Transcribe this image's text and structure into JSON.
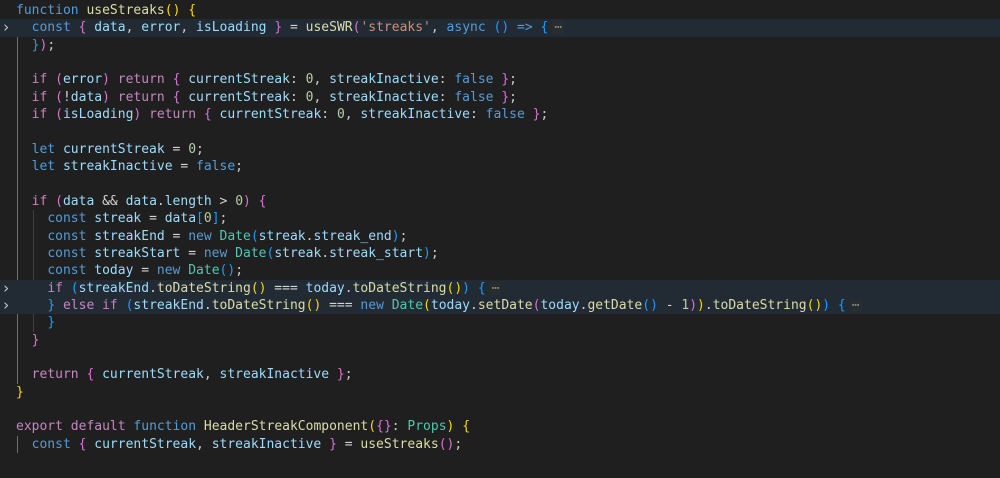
{
  "colors": {
    "keyword": "#569cd6",
    "control": "#c586c0",
    "function": "#dcdcaa",
    "variable": "#9cdcfe",
    "property": "#9cdcfe",
    "type": "#4ec9b0",
    "string": "#ce9178",
    "number": "#b5cea8",
    "operator": "#d4d4d4",
    "punctuation": "#cccccc",
    "bracket1": "#ffd700",
    "bracket2": "#da70d6",
    "bracket3": "#179fff",
    "ellipsis": "#8a8a8a"
  },
  "fold_icon": "chevron-right-icon",
  "ellipsis_text": "⋯",
  "lines": [
    {
      "fold": false,
      "tokens": [
        [
          "function",
          "keyword"
        ],
        [
          " ",
          "text"
        ],
        [
          "useStreaks",
          "function"
        ],
        [
          "(",
          "bracket1"
        ],
        [
          ")",
          "bracket1"
        ],
        [
          " ",
          "text"
        ],
        [
          "{",
          "bracket1"
        ]
      ]
    },
    {
      "fold": true,
      "collapsed": true,
      "tokens": [
        [
          "  ",
          "text"
        ],
        [
          "const",
          "keyword"
        ],
        [
          " ",
          "text"
        ],
        [
          "{",
          "bracket2"
        ],
        [
          " ",
          "text"
        ],
        [
          "data",
          "variable"
        ],
        [
          ", ",
          "text"
        ],
        [
          "error",
          "variable"
        ],
        [
          ", ",
          "text"
        ],
        [
          "isLoading",
          "variable"
        ],
        [
          " ",
          "text"
        ],
        [
          "}",
          "bracket2"
        ],
        [
          " = ",
          "operator"
        ],
        [
          "useSWR",
          "function"
        ],
        [
          "(",
          "bracket2"
        ],
        [
          "'streaks'",
          "string"
        ],
        [
          ", ",
          "text"
        ],
        [
          "async",
          "keyword"
        ],
        [
          " ",
          "text"
        ],
        [
          "(",
          "bracket3"
        ],
        [
          ")",
          "bracket3"
        ],
        [
          " ",
          "text"
        ],
        [
          "=>",
          "keyword"
        ],
        [
          " ",
          "text"
        ],
        [
          "{",
          "bracket3"
        ]
      ]
    },
    {
      "fold": false,
      "tokens": [
        [
          "  ",
          "text"
        ],
        [
          "}",
          "bracket3"
        ],
        [
          ")",
          "bracket2"
        ],
        [
          ";",
          "text"
        ]
      ]
    },
    {
      "fold": false,
      "tokens": []
    },
    {
      "fold": false,
      "tokens": [
        [
          "  ",
          "text"
        ],
        [
          "if",
          "control"
        ],
        [
          " ",
          "text"
        ],
        [
          "(",
          "bracket2"
        ],
        [
          "error",
          "variable"
        ],
        [
          ")",
          "bracket2"
        ],
        [
          " ",
          "text"
        ],
        [
          "return",
          "control"
        ],
        [
          " ",
          "text"
        ],
        [
          "{",
          "bracket2"
        ],
        [
          " ",
          "text"
        ],
        [
          "currentStreak",
          "property"
        ],
        [
          ": ",
          "text"
        ],
        [
          "0",
          "number"
        ],
        [
          ", ",
          "text"
        ],
        [
          "streakInactive",
          "property"
        ],
        [
          ": ",
          "text"
        ],
        [
          "false",
          "keyword"
        ],
        [
          " ",
          "text"
        ],
        [
          "}",
          "bracket2"
        ],
        [
          ";",
          "text"
        ]
      ]
    },
    {
      "fold": false,
      "tokens": [
        [
          "  ",
          "text"
        ],
        [
          "if",
          "control"
        ],
        [
          " ",
          "text"
        ],
        [
          "(",
          "bracket2"
        ],
        [
          "!",
          "operator"
        ],
        [
          "data",
          "variable"
        ],
        [
          ")",
          "bracket2"
        ],
        [
          " ",
          "text"
        ],
        [
          "return",
          "control"
        ],
        [
          " ",
          "text"
        ],
        [
          "{",
          "bracket2"
        ],
        [
          " ",
          "text"
        ],
        [
          "currentStreak",
          "property"
        ],
        [
          ": ",
          "text"
        ],
        [
          "0",
          "number"
        ],
        [
          ", ",
          "text"
        ],
        [
          "streakInactive",
          "property"
        ],
        [
          ": ",
          "text"
        ],
        [
          "false",
          "keyword"
        ],
        [
          " ",
          "text"
        ],
        [
          "}",
          "bracket2"
        ],
        [
          ";",
          "text"
        ]
      ]
    },
    {
      "fold": false,
      "tokens": [
        [
          "  ",
          "text"
        ],
        [
          "if",
          "control"
        ],
        [
          " ",
          "text"
        ],
        [
          "(",
          "bracket2"
        ],
        [
          "isLoading",
          "variable"
        ],
        [
          ")",
          "bracket2"
        ],
        [
          " ",
          "text"
        ],
        [
          "return",
          "control"
        ],
        [
          " ",
          "text"
        ],
        [
          "{",
          "bracket2"
        ],
        [
          " ",
          "text"
        ],
        [
          "currentStreak",
          "property"
        ],
        [
          ": ",
          "text"
        ],
        [
          "0",
          "number"
        ],
        [
          ", ",
          "text"
        ],
        [
          "streakInactive",
          "property"
        ],
        [
          ": ",
          "text"
        ],
        [
          "false",
          "keyword"
        ],
        [
          " ",
          "text"
        ],
        [
          "}",
          "bracket2"
        ],
        [
          ";",
          "text"
        ]
      ]
    },
    {
      "fold": false,
      "tokens": []
    },
    {
      "fold": false,
      "tokens": [
        [
          "  ",
          "text"
        ],
        [
          "let",
          "keyword"
        ],
        [
          " ",
          "text"
        ],
        [
          "currentStreak",
          "variable"
        ],
        [
          " = ",
          "operator"
        ],
        [
          "0",
          "number"
        ],
        [
          ";",
          "text"
        ]
      ]
    },
    {
      "fold": false,
      "tokens": [
        [
          "  ",
          "text"
        ],
        [
          "let",
          "keyword"
        ],
        [
          " ",
          "text"
        ],
        [
          "streakInactive",
          "variable"
        ],
        [
          " = ",
          "operator"
        ],
        [
          "false",
          "keyword"
        ],
        [
          ";",
          "text"
        ]
      ]
    },
    {
      "fold": false,
      "tokens": []
    },
    {
      "fold": false,
      "tokens": [
        [
          "  ",
          "text"
        ],
        [
          "if",
          "control"
        ],
        [
          " ",
          "text"
        ],
        [
          "(",
          "bracket2"
        ],
        [
          "data",
          "variable"
        ],
        [
          " && ",
          "operator"
        ],
        [
          "data",
          "variable"
        ],
        [
          ".",
          "text"
        ],
        [
          "length",
          "property"
        ],
        [
          " > ",
          "operator"
        ],
        [
          "0",
          "number"
        ],
        [
          ")",
          "bracket2"
        ],
        [
          " ",
          "text"
        ],
        [
          "{",
          "bracket2"
        ]
      ]
    },
    {
      "fold": false,
      "tokens": [
        [
          "    ",
          "text"
        ],
        [
          "const",
          "keyword"
        ],
        [
          " ",
          "text"
        ],
        [
          "streak",
          "variable"
        ],
        [
          " = ",
          "operator"
        ],
        [
          "data",
          "variable"
        ],
        [
          "[",
          "bracket3"
        ],
        [
          "0",
          "number"
        ],
        [
          "]",
          "bracket3"
        ],
        [
          ";",
          "text"
        ]
      ]
    },
    {
      "fold": false,
      "tokens": [
        [
          "    ",
          "text"
        ],
        [
          "const",
          "keyword"
        ],
        [
          " ",
          "text"
        ],
        [
          "streakEnd",
          "variable"
        ],
        [
          " = ",
          "operator"
        ],
        [
          "new",
          "keyword"
        ],
        [
          " ",
          "text"
        ],
        [
          "Date",
          "type"
        ],
        [
          "(",
          "bracket3"
        ],
        [
          "streak",
          "variable"
        ],
        [
          ".",
          "text"
        ],
        [
          "streak_end",
          "property"
        ],
        [
          ")",
          "bracket3"
        ],
        [
          ";",
          "text"
        ]
      ]
    },
    {
      "fold": false,
      "tokens": [
        [
          "    ",
          "text"
        ],
        [
          "const",
          "keyword"
        ],
        [
          " ",
          "text"
        ],
        [
          "streakStart",
          "variable"
        ],
        [
          " = ",
          "operator"
        ],
        [
          "new",
          "keyword"
        ],
        [
          " ",
          "text"
        ],
        [
          "Date",
          "type"
        ],
        [
          "(",
          "bracket3"
        ],
        [
          "streak",
          "variable"
        ],
        [
          ".",
          "text"
        ],
        [
          "streak_start",
          "property"
        ],
        [
          ")",
          "bracket3"
        ],
        [
          ";",
          "text"
        ]
      ]
    },
    {
      "fold": false,
      "tokens": [
        [
          "    ",
          "text"
        ],
        [
          "const",
          "keyword"
        ],
        [
          " ",
          "text"
        ],
        [
          "today",
          "variable"
        ],
        [
          " = ",
          "operator"
        ],
        [
          "new",
          "keyword"
        ],
        [
          " ",
          "text"
        ],
        [
          "Date",
          "type"
        ],
        [
          "(",
          "bracket3"
        ],
        [
          ")",
          "bracket3"
        ],
        [
          ";",
          "text"
        ]
      ]
    },
    {
      "fold": true,
      "collapsed": true,
      "tokens": [
        [
          "    ",
          "text"
        ],
        [
          "if",
          "control"
        ],
        [
          " ",
          "text"
        ],
        [
          "(",
          "bracket3"
        ],
        [
          "streakEnd",
          "variable"
        ],
        [
          ".",
          "text"
        ],
        [
          "toDateString",
          "function"
        ],
        [
          "(",
          "bracket1"
        ],
        [
          ")",
          "bracket1"
        ],
        [
          " === ",
          "operator"
        ],
        [
          "today",
          "variable"
        ],
        [
          ".",
          "text"
        ],
        [
          "toDateString",
          "function"
        ],
        [
          "(",
          "bracket1"
        ],
        [
          ")",
          "bracket1"
        ],
        [
          ")",
          "bracket3"
        ],
        [
          " ",
          "text"
        ],
        [
          "{",
          "bracket3"
        ]
      ]
    },
    {
      "fold": true,
      "collapsed": true,
      "tokens": [
        [
          "    ",
          "text"
        ],
        [
          "}",
          "bracket3"
        ],
        [
          " ",
          "text"
        ],
        [
          "else",
          "control"
        ],
        [
          " ",
          "text"
        ],
        [
          "if",
          "control"
        ],
        [
          " ",
          "text"
        ],
        [
          "(",
          "bracket3"
        ],
        [
          "streakEnd",
          "variable"
        ],
        [
          ".",
          "text"
        ],
        [
          "toDateString",
          "function"
        ],
        [
          "(",
          "bracket1"
        ],
        [
          ")",
          "bracket1"
        ],
        [
          " === ",
          "operator"
        ],
        [
          "new",
          "keyword"
        ],
        [
          " ",
          "text"
        ],
        [
          "Date",
          "type"
        ],
        [
          "(",
          "bracket1"
        ],
        [
          "today",
          "variable"
        ],
        [
          ".",
          "text"
        ],
        [
          "setDate",
          "function"
        ],
        [
          "(",
          "bracket2"
        ],
        [
          "today",
          "variable"
        ],
        [
          ".",
          "text"
        ],
        [
          "getDate",
          "function"
        ],
        [
          "(",
          "bracket3"
        ],
        [
          ")",
          "bracket3"
        ],
        [
          " - ",
          "operator"
        ],
        [
          "1",
          "number"
        ],
        [
          ")",
          "bracket2"
        ],
        [
          ")",
          "bracket1"
        ],
        [
          ".",
          "text"
        ],
        [
          "toDateString",
          "function"
        ],
        [
          "(",
          "bracket1"
        ],
        [
          ")",
          "bracket1"
        ],
        [
          ")",
          "bracket3"
        ],
        [
          " ",
          "text"
        ],
        [
          "{",
          "bracket3"
        ]
      ]
    },
    {
      "fold": false,
      "tokens": [
        [
          "    ",
          "text"
        ],
        [
          "}",
          "bracket3"
        ]
      ]
    },
    {
      "fold": false,
      "tokens": [
        [
          "  ",
          "text"
        ],
        [
          "}",
          "bracket2"
        ]
      ]
    },
    {
      "fold": false,
      "tokens": []
    },
    {
      "fold": false,
      "tokens": [
        [
          "  ",
          "text"
        ],
        [
          "return",
          "control"
        ],
        [
          " ",
          "text"
        ],
        [
          "{",
          "bracket2"
        ],
        [
          " ",
          "text"
        ],
        [
          "currentStreak",
          "variable"
        ],
        [
          ", ",
          "text"
        ],
        [
          "streakInactive",
          "variable"
        ],
        [
          " ",
          "text"
        ],
        [
          "}",
          "bracket2"
        ],
        [
          ";",
          "text"
        ]
      ]
    },
    {
      "fold": false,
      "tokens": [
        [
          "}",
          "bracket1"
        ]
      ]
    },
    {
      "fold": false,
      "tokens": []
    },
    {
      "fold": false,
      "tokens": [
        [
          "export",
          "control"
        ],
        [
          " ",
          "text"
        ],
        [
          "default",
          "control"
        ],
        [
          " ",
          "text"
        ],
        [
          "function",
          "keyword"
        ],
        [
          " ",
          "text"
        ],
        [
          "HeaderStreakComponent",
          "function"
        ],
        [
          "(",
          "bracket1"
        ],
        [
          "{",
          "bracket2"
        ],
        [
          "}",
          "bracket2"
        ],
        [
          ": ",
          "text"
        ],
        [
          "Props",
          "type"
        ],
        [
          ")",
          "bracket1"
        ],
        [
          " ",
          "text"
        ],
        [
          "{",
          "bracket1"
        ]
      ]
    },
    {
      "fold": false,
      "tokens": [
        [
          "  ",
          "text"
        ],
        [
          "const",
          "keyword"
        ],
        [
          " ",
          "text"
        ],
        [
          "{",
          "bracket2"
        ],
        [
          " ",
          "text"
        ],
        [
          "currentStreak",
          "variable"
        ],
        [
          ", ",
          "text"
        ],
        [
          "streakInactive",
          "variable"
        ],
        [
          " ",
          "text"
        ],
        [
          "}",
          "bracket2"
        ],
        [
          " = ",
          "operator"
        ],
        [
          "useStreaks",
          "function"
        ],
        [
          "(",
          "bracket2"
        ],
        [
          ")",
          "bracket2"
        ],
        [
          ";",
          "text"
        ]
      ]
    }
  ]
}
